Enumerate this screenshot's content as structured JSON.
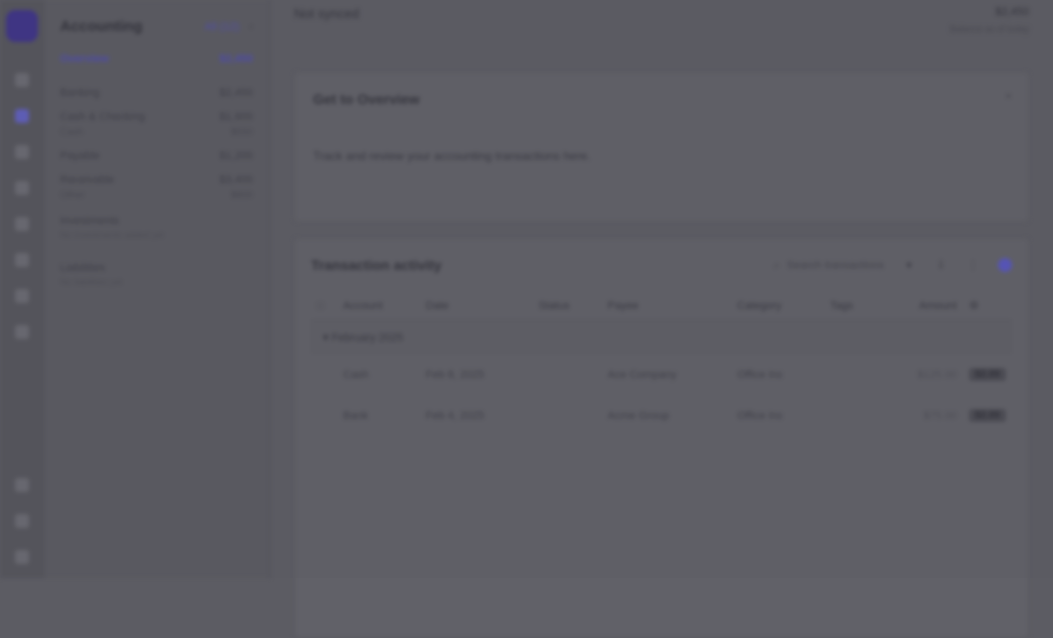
{
  "app": {
    "title": "Accounting"
  },
  "sidebar": {
    "title": "Accounting",
    "header_link": "All (12)",
    "header_chevron": "‹",
    "items": [
      {
        "label": "Overview",
        "value": "$2,450"
      },
      {
        "label": "Banking",
        "value": "$2,450"
      },
      {
        "label": "Cash & Checking",
        "value": "$1,900"
      },
      {
        "label": "Cash",
        "value": "$550"
      },
      {
        "label": "Payable",
        "value": "$1,200"
      },
      {
        "label": "Receivable",
        "value": "$3,400"
      },
      {
        "label": "Other",
        "value": "$800"
      }
    ],
    "groups": [
      {
        "label": "Investments",
        "sub": "No investments added yet"
      },
      {
        "label": "Liabilities",
        "sub": "No liabilities yet"
      }
    ]
  },
  "topbar": {
    "breadcrumb": "Not synced",
    "right_title": "$2,450",
    "right_sub": "Balance as of today"
  },
  "card_one": {
    "title": "Get to Overview",
    "close_label": "×",
    "description": "Track and review your accounting transactions here."
  },
  "card_two": {
    "title": "Transaction activity",
    "search_placeholder": "Search transactions",
    "columns": [
      "Account",
      "Date",
      "Status",
      "Payee",
      "Category",
      "Tags",
      "Amount",
      ""
    ],
    "group_label": "February 2025",
    "rows": [
      {
        "account": "Cash",
        "date": "Feb 8, 2025",
        "status": "",
        "payee": "Ace Company",
        "category": "Office Inc",
        "tags": "",
        "amount": "$125.00",
        "badge": "$2.00"
      },
      {
        "account": "Bank",
        "date": "Feb 4, 2025",
        "status": "",
        "payee": "Acme Group",
        "category": "Office Inc",
        "tags": "",
        "amount": "$75.00",
        "badge": "$2.00"
      }
    ]
  }
}
